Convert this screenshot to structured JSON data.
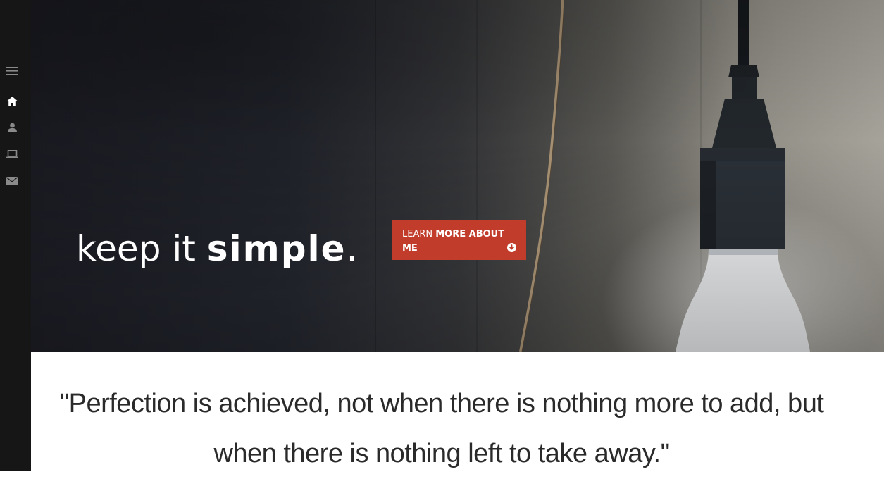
{
  "sidebar": {
    "items": [
      {
        "icon": "menu-icon"
      },
      {
        "icon": "home-icon"
      },
      {
        "icon": "user-icon"
      },
      {
        "icon": "laptop-icon"
      },
      {
        "icon": "envelope-icon"
      }
    ]
  },
  "hero": {
    "title_light": "keep it ",
    "title_bold": "simple",
    "title_period": ".",
    "cta_light": "LEARN ",
    "cta_bold": "MORE ABOUT ME",
    "cta_icon": "arrow-circle-down-icon"
  },
  "quote": {
    "text": "\"Perfection is achieved, not when there is nothing more to add, but when there is nothing left to take away.\""
  },
  "colors": {
    "sidebar": "#161616",
    "accent": "#c23c2c",
    "text": "#2a2a2a"
  }
}
